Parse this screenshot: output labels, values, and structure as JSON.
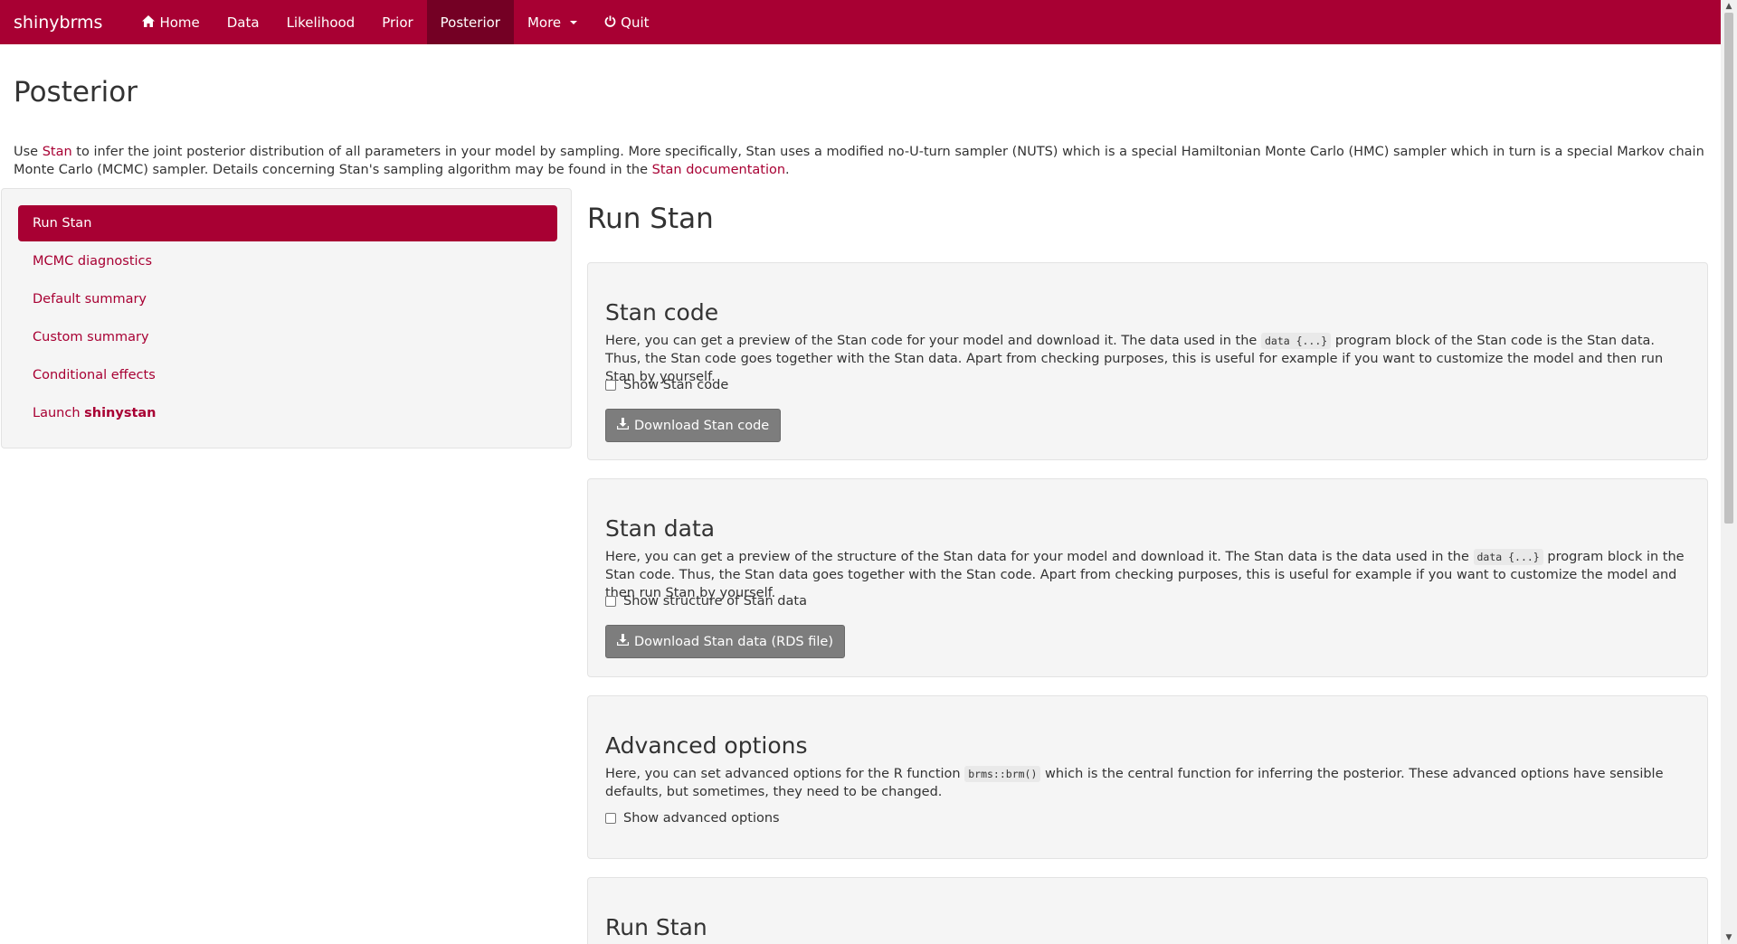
{
  "navbar": {
    "brand": "shinybrms",
    "items": [
      {
        "label": "Home",
        "icon": "home-icon"
      },
      {
        "label": "Data"
      },
      {
        "label": "Likelihood"
      },
      {
        "label": "Prior"
      },
      {
        "label": "Posterior",
        "active": true
      },
      {
        "label": "More",
        "icon": "caret-down-icon"
      },
      {
        "label": "Quit",
        "icon": "power-icon"
      }
    ],
    "accent_color": "#a80033",
    "active_color": "#740024"
  },
  "page": {
    "title": "Posterior",
    "intro": {
      "t1": "Use ",
      "link1": "Stan",
      "t2": " to infer the joint posterior distribution of all parameters in your model by sampling. More specifically, Stan uses a modified no-U-turn sampler (NUTS) which is a special Hamiltonian Monte Carlo (HMC) sampler which in turn is a special Markov chain Monte Carlo (MCMC) sampler. Details concerning Stan's sampling algorithm may be found in the ",
      "link2": "Stan documentation",
      "t3": "."
    }
  },
  "sidebar": {
    "items": [
      {
        "label": "Run Stan",
        "active": true
      },
      {
        "label": "MCMC diagnostics"
      },
      {
        "label": "Default summary"
      },
      {
        "label": "Custom summary"
      },
      {
        "label": "Conditional effects"
      },
      {
        "label_prefix": "Launch ",
        "label_bold": "shinystan"
      }
    ]
  },
  "main": {
    "title": "Run Stan",
    "stan_code": {
      "heading": "Stan code",
      "desc_pre": "Here, you can get a preview of the Stan code for your model and download it. The data used in the ",
      "code": "data {...}",
      "desc_post": " program block of the Stan code is the Stan data. Thus, the Stan code goes together with the Stan data. Apart from checking purposes, this is useful for example if you want to customize the model and then run Stan by yourself.",
      "checkbox_label": "Show Stan code",
      "checked": false,
      "button_label": "Download Stan code"
    },
    "stan_data": {
      "heading": "Stan data",
      "desc_pre": "Here, you can get a preview of the structure of the Stan data for your model and download it. The Stan data is the data used in the ",
      "code": "data {...}",
      "desc_post": " program block in the Stan code. Thus, the Stan data goes together with the Stan code. Apart from checking purposes, this is useful for example if you want to customize the model and then run Stan by yourself.",
      "checkbox_label": "Show structure of Stan data",
      "checked": false,
      "button_label": "Download Stan data (RDS file)"
    },
    "advanced": {
      "heading": "Advanced options",
      "desc_pre": "Here, you can set advanced options for the R function ",
      "code": "brms::brm()",
      "desc_post": " which is the central function for inferring the posterior. These advanced options have sensible defaults, but sometimes, they need to be changed.",
      "checkbox_label": "Show advanced options",
      "checked": false
    },
    "run": {
      "heading": "Run Stan"
    }
  }
}
